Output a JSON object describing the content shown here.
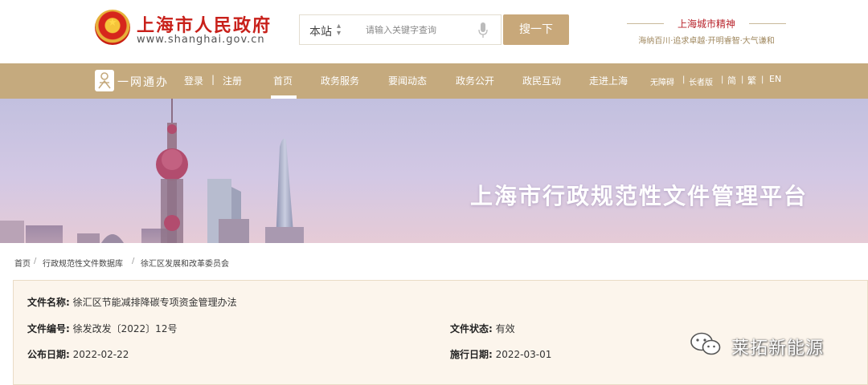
{
  "header": {
    "site_name": "上海市人民政府",
    "site_url": "www.shanghai.gov.cn",
    "emblem_glyph": "★",
    "search": {
      "scope": "本站",
      "placeholder": "请输入关键字查询",
      "button": "搜一下"
    },
    "spirit": {
      "title": "上海城市精神",
      "subtitle": "海纳百川·追求卓越·开明睿智·大气谦和"
    }
  },
  "nav": {
    "onenet": "一网通办",
    "login": "登录",
    "sep": "|",
    "register": "注册",
    "items": [
      "首页",
      "政务服务",
      "要闻动态",
      "政务公开",
      "政民互动",
      "走进上海"
    ],
    "active_index": 0,
    "accessibility": "无障碍",
    "elder": "长者版",
    "simplified": "简",
    "traditional": "繁",
    "english": "EN",
    "small_sep": "|"
  },
  "banner": {
    "title": "上海市行政规范性文件管理平台"
  },
  "breadcrumb": {
    "items": [
      "首页",
      "行政规范性文件数据库",
      "徐汇区发展和改革委员会"
    ],
    "sep": "/"
  },
  "document": {
    "name_label": "文件名称:",
    "name": "徐汇区节能减排降碳专项资金管理办法",
    "number_label": "文件编号:",
    "number": "徐发改发〔2022〕12号",
    "status_label": "文件状态:",
    "status": "有效",
    "publish_label": "公布日期:",
    "publish_date": "2022-02-22",
    "effective_label": "施行日期:",
    "effective_date": "2022-03-01"
  },
  "watermark": {
    "text": "莱拓新能源"
  },
  "colors": {
    "brand_red": "#c8201a",
    "nav_gold": "#c5aa7e",
    "search_button": "#c8a87a",
    "panel_bg": "#fcf5ec"
  }
}
